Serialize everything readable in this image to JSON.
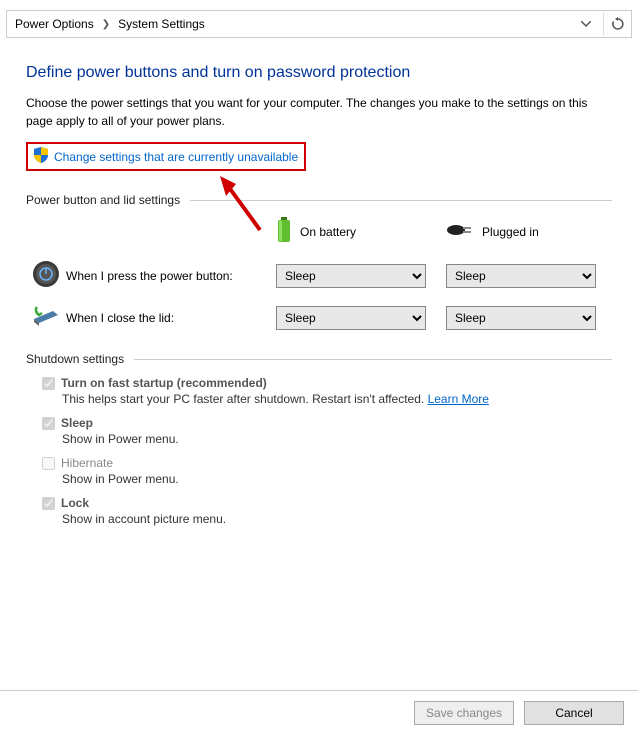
{
  "breadcrumb": {
    "level1": "Power Options",
    "level2": "System Settings"
  },
  "page": {
    "title": "Define power buttons and turn on password protection",
    "description": "Choose the power settings that you want for your computer. The changes you make to the settings on this page apply to all of your power plans.",
    "change_link": "Change settings that are currently unavailable"
  },
  "sections": {
    "power_button": "Power button and lid settings",
    "shutdown": "Shutdown settings"
  },
  "columns": {
    "battery": "On battery",
    "plugged": "Plugged in"
  },
  "rows": {
    "press_button": {
      "label": "When I press the power button:",
      "battery_value": "Sleep",
      "plugged_value": "Sleep"
    },
    "close_lid": {
      "label": "When I close the lid:",
      "battery_value": "Sleep",
      "plugged_value": "Sleep"
    }
  },
  "shutdown": {
    "fast_startup": {
      "label": "Turn on fast startup (recommended)",
      "desc": "This helps start your PC faster after shutdown. Restart isn't affected. ",
      "learn_more": "Learn More",
      "checked": true
    },
    "sleep": {
      "label": "Sleep",
      "desc": "Show in Power menu.",
      "checked": true
    },
    "hibernate": {
      "label": "Hibernate",
      "desc": "Show in Power menu.",
      "checked": false
    },
    "lock": {
      "label": "Lock",
      "desc": "Show in account picture menu.",
      "checked": true
    }
  },
  "footer": {
    "save": "Save changes",
    "cancel": "Cancel"
  }
}
